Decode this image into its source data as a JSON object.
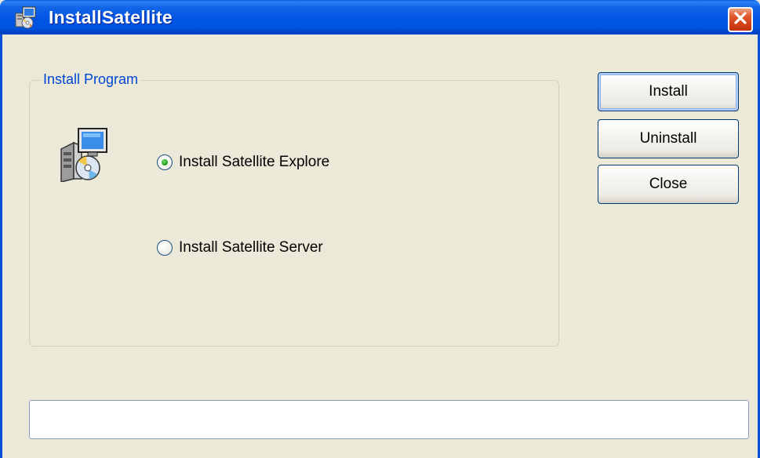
{
  "window": {
    "title": "InstallSatellite",
    "icon": "installer-icon",
    "close_icon": "close-icon"
  },
  "group": {
    "legend": "Install Program",
    "icon": "setup-package-icon",
    "options": [
      {
        "label": "Install Satellite Explore",
        "checked": true
      },
      {
        "label": "Install Satellite Server",
        "checked": false
      }
    ]
  },
  "buttons": {
    "install_label": "Install",
    "uninstall_label": "Uninstall",
    "close_label": "Close"
  },
  "status": {
    "value": ""
  },
  "colors": {
    "titlebar": "#0055E5",
    "close_button": "#D14218",
    "face": "#ECE9D8",
    "legend_text": "#0046D5",
    "radio_selected": "#21A121"
  }
}
